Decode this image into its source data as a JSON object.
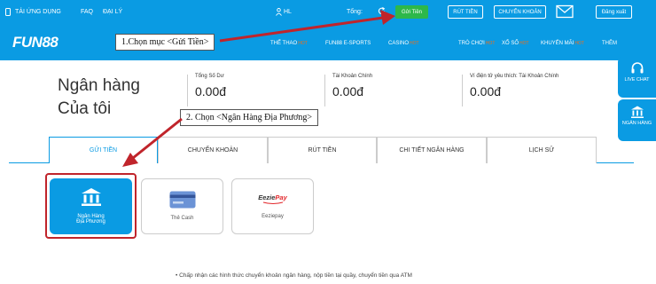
{
  "topbar": {
    "app_download": "TẢI ỨNG DỤNG",
    "faq": "FAQ",
    "agent": "ĐẠI LÝ",
    "username": "HL",
    "total_label": "Tổng:",
    "deposit_btn": "Gửi Tiền",
    "withdraw_btn": "RÚT TIỀN",
    "transfer_btn": "CHUYỂN KHOẢN",
    "logout_btn": "Đăng xuất"
  },
  "navbar": {
    "logo": "FUN88",
    "items": [
      {
        "label": "THỂ THAO",
        "badge": "HOT"
      },
      {
        "label": "FUN88 E-SPORTS",
        "badge": ""
      },
      {
        "label": "CASINO",
        "badge": "HOT"
      },
      {
        "label": "TRÒ CHƠI",
        "badge": "HOT"
      },
      {
        "label": "XỔ SỐ",
        "badge": "HOT"
      },
      {
        "label": "KHUYẾN MÃI",
        "badge": "HOT"
      },
      {
        "label": "THÊM",
        "badge": ""
      }
    ]
  },
  "side": {
    "live_chat": "LIVE CHAT",
    "bank": "NGÂN HÀNG"
  },
  "page": {
    "title_line1": "Ngân hàng",
    "title_line2": "Của tôi"
  },
  "balances": [
    {
      "label": "Tổng Số Dư",
      "value": "0.00đ"
    },
    {
      "label": "Tài Khoản Chính",
      "value": "0.00đ"
    },
    {
      "label": "Ví điện tử yêu thích: Tài Khoản Chính",
      "value": "0.00đ"
    }
  ],
  "tabs": [
    "GỬI TIỀN",
    "CHUYỂN KHOẢN",
    "RÚT TIỀN",
    "CHI TIẾT NGÂN HÀNG",
    "LỊCH SỬ"
  ],
  "methods": [
    {
      "line1": "Ngân Hàng",
      "line2": "Địa Phương"
    },
    {
      "line1": "Thẻ Cash",
      "line2": ""
    },
    {
      "line1": "Eeziepay",
      "line2": ""
    }
  ],
  "eeziepay_logo": {
    "part1": "Eezie",
    "part2": "Pay"
  },
  "callouts": {
    "step1": "1.Chọn mục <Gửi Tiền>",
    "step2": "2. Chọn <Ngân Hàng Địa Phương>"
  },
  "note": "Chấp nhận các hình thức chuyển khoản ngân hàng, nộp tiền tại quầy, chuyển tiền qua ATM",
  "colors": {
    "brand_blue": "#0a9be3",
    "deposit_green": "#2db84a",
    "annotation_red": "#c0242b",
    "hot_orange": "#f36e16"
  }
}
